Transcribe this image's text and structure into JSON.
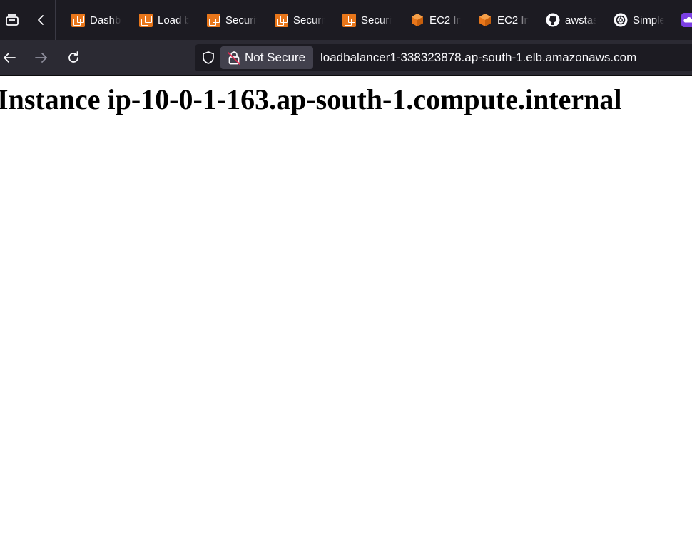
{
  "browser": {
    "tabs": [
      {
        "label": "Dashb",
        "icon": "aws-console-icon"
      },
      {
        "label": "Load b",
        "icon": "aws-console-icon"
      },
      {
        "label": "Securit",
        "icon": "aws-console-icon"
      },
      {
        "label": "Securit",
        "icon": "aws-console-icon"
      },
      {
        "label": "Securit",
        "icon": "aws-console-icon"
      },
      {
        "label": "EC2 In",
        "icon": "ec2-icon"
      },
      {
        "label": "EC2 In",
        "icon": "ec2-icon"
      },
      {
        "label": "awstas",
        "icon": "github-icon"
      },
      {
        "label": "Simple",
        "icon": "openai-icon"
      }
    ],
    "security_label": "Not Secure",
    "url": "loadbalancer1-338323878.ap-south-1.elb.amazonaws.com",
    "colors": {
      "tabstrip_bg": "#1c1b22",
      "navbar_bg": "#2b2a33",
      "urlbar_bg": "#1c1b22",
      "aws_orange": "#e8761a",
      "insecure_red": "#e22850"
    }
  },
  "page": {
    "heading": "Instance ip-10-0-1-163.ap-south-1.compute.internal"
  }
}
